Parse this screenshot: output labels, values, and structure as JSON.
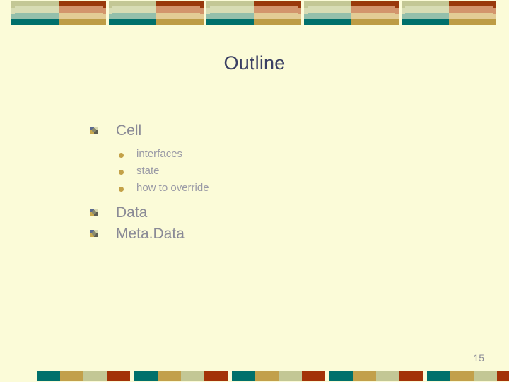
{
  "slide": {
    "title": "Outline",
    "page_number": "15",
    "background_color": "#fbfbd8",
    "title_color": "#3a3f63",
    "body_text_color": "#8a8a96"
  },
  "decor": {
    "top_block_count": 5,
    "bottom_group_count": 5,
    "top_left_colors": [
      "#c3c795",
      "#d7dcb4",
      "#93bfab",
      "#00706b"
    ],
    "top_right_colors": [
      "#99390b",
      "#d3956c",
      "#e3cc95",
      "#bd9c45"
    ],
    "bottom_bar_colors": [
      "#00706b",
      "#c2a04b",
      "#c3c795",
      "#a33208"
    ]
  },
  "outline": {
    "items": [
      {
        "label": "Cell",
        "level": 1,
        "children": [
          {
            "label": "interfaces",
            "level": 2
          },
          {
            "label": "state",
            "level": 2
          },
          {
            "label": "how to override",
            "level": 2
          }
        ]
      },
      {
        "label": "Data",
        "level": 1,
        "children": []
      },
      {
        "label": "Meta.Data",
        "level": 1,
        "children": []
      }
    ]
  }
}
